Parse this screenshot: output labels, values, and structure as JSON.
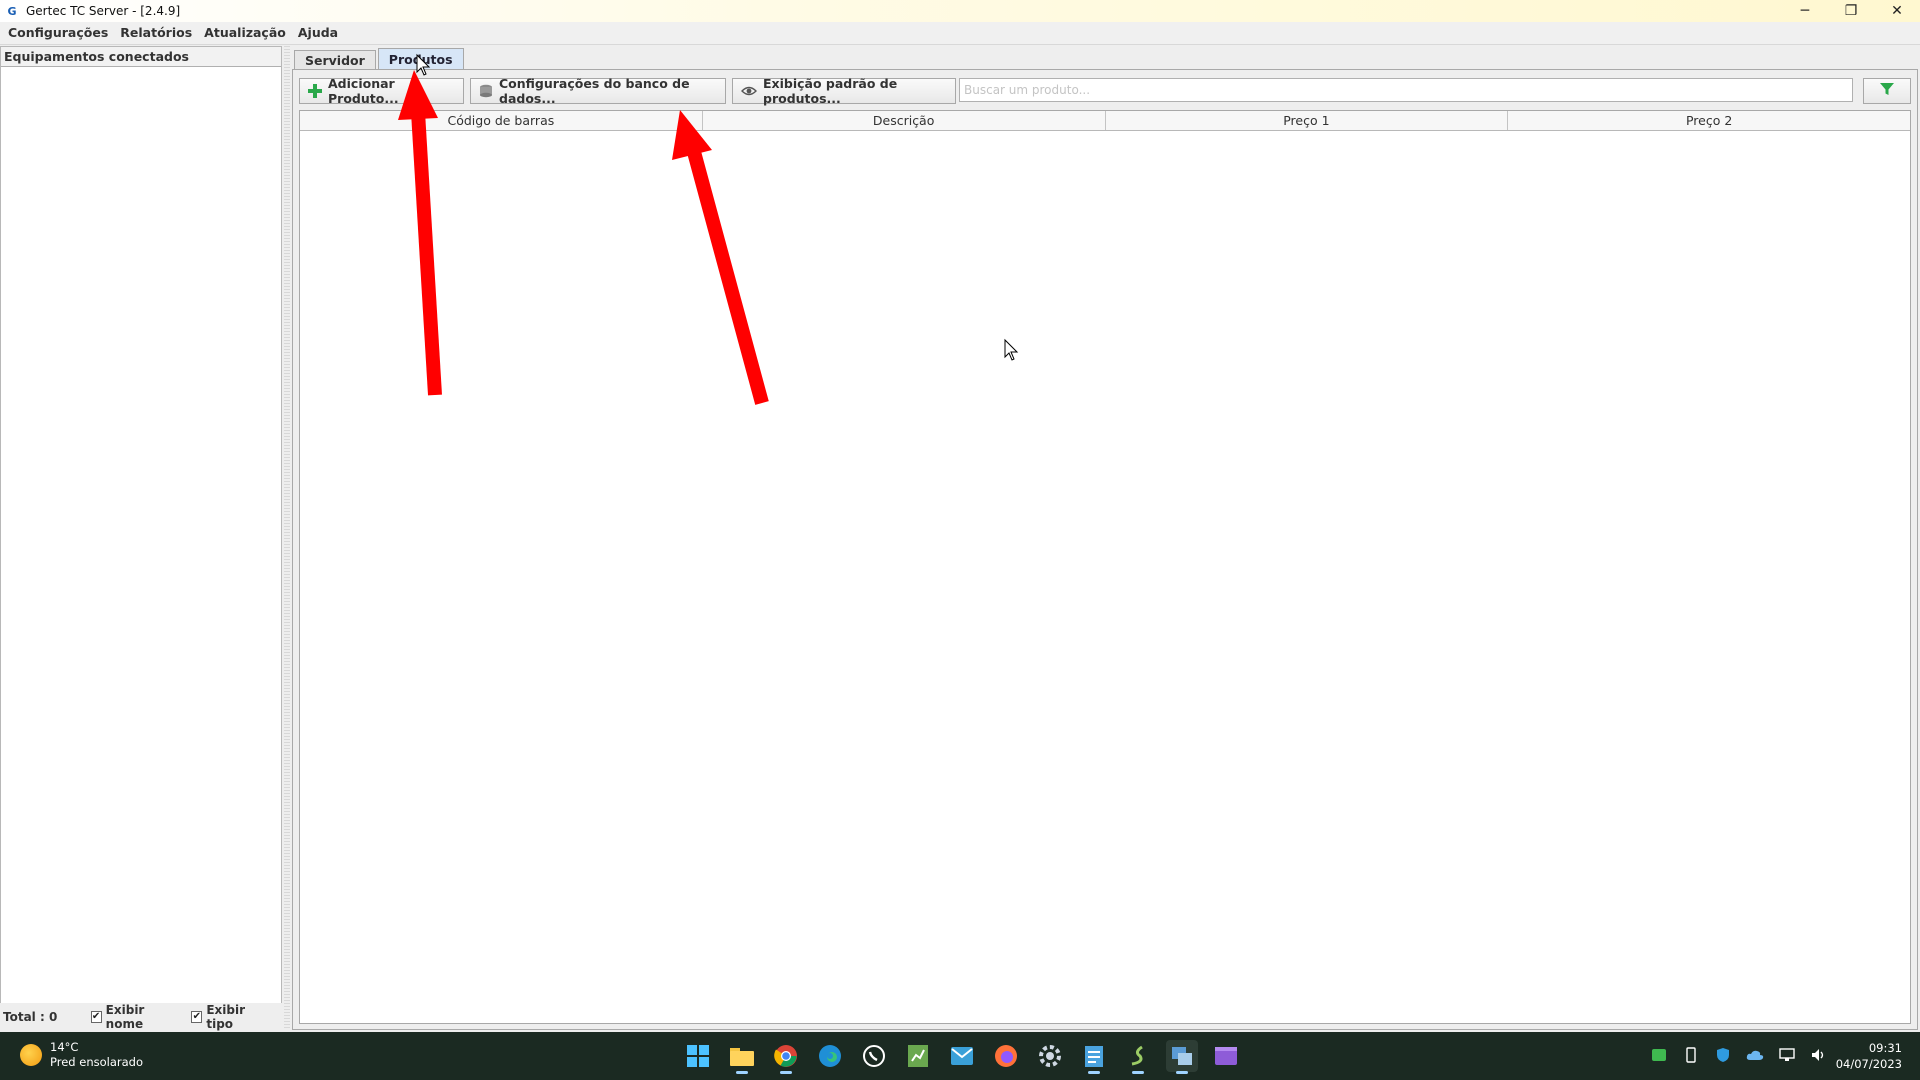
{
  "window": {
    "title": "Gertec TC Server - [2.4.9]",
    "icon_name": "gertec-app-icon",
    "controls": {
      "minimize": "─",
      "restore": "❐",
      "close": "✕"
    }
  },
  "menu": {
    "items": [
      "Configurações",
      "Relatórios",
      "Atualização",
      "Ajuda"
    ]
  },
  "left_panel": {
    "header": "Equipamentos conectados",
    "total_label": "Total : 0",
    "checkbox_name_label": "Exibir nome",
    "checkbox_type_label": "Exibir tipo",
    "checkbox_name_checked": true,
    "checkbox_type_checked": true
  },
  "tabs": {
    "items": [
      "Servidor",
      "Produtos"
    ],
    "active": "Produtos"
  },
  "toolbar": {
    "add_product_label": "Adicionar Produto...",
    "db_config_label": "Configurações do banco de dados...",
    "default_display_label": "Exibição padrão de produtos...",
    "search_placeholder": "Buscar um produto...",
    "search_value": "",
    "filter_icon": "filter-icon"
  },
  "table": {
    "columns": [
      "Código de barras",
      "Descrição",
      "Preço 1",
      "Preço 2"
    ],
    "rows": []
  },
  "taskbar": {
    "weather_temp": "14°C",
    "weather_desc": "Pred ensolarado",
    "time": "09:31",
    "date": "04/07/2023",
    "apps": [
      "start-icon",
      "file-explorer-icon",
      "chrome-icon",
      "edge-icon",
      "whatsapp-icon",
      "spreadsheet-icon",
      "mail-icon",
      "firefox-icon",
      "settings-icon",
      "notepad-icon",
      "snake-app-icon",
      "gertec-tc-server-icon",
      "video-editor-icon"
    ]
  },
  "colors": {
    "annotation_arrow": "#ff0000",
    "active_tab": "#d7e6f7",
    "taskbar": "#1b2a22",
    "filter_icon": "#2aa84a",
    "add_icon": "#2aa84a"
  }
}
